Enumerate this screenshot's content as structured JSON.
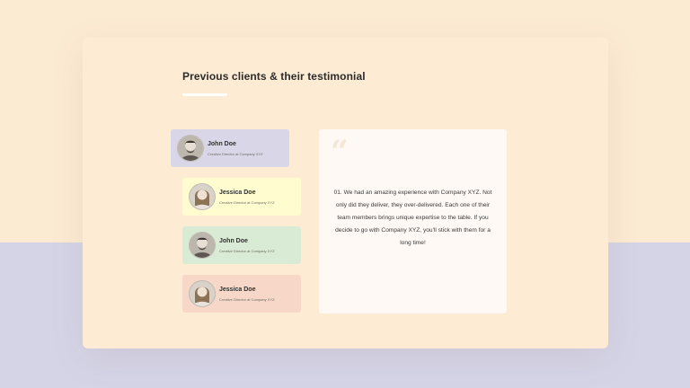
{
  "colors": {
    "page_top": "#FCEBD3",
    "page_bottom": "#D5D4E7",
    "card": "#FEEBD4",
    "client_1": "#D9D6E8",
    "client_2": "#FFFDCF",
    "client_3": "#D9EBD4",
    "client_4": "#F6D7C8",
    "quote_panel": "#FFF9F5"
  },
  "section": {
    "title": "Previous clients & their testimonial"
  },
  "clients": [
    {
      "name": "John Doe",
      "role": "Creative Director at Company XYZ",
      "avatar_icon": "man-avatar-icon"
    },
    {
      "name": "Jessica Doe",
      "role": "Creative Director at Company XYZ",
      "avatar_icon": "woman-avatar-icon"
    },
    {
      "name": "John Doe",
      "role": "Creative Director at Company XYZ",
      "avatar_icon": "man-avatar-icon"
    },
    {
      "name": "Jessica Doe",
      "role": "Creative Director at Company XYZ",
      "avatar_icon": "woman-avatar-icon"
    }
  ],
  "testimonial": {
    "quote_icon": "quote-icon",
    "text": "01. We had an amazing experience with Company XYZ. Not only did they deliver, they over-delivered. Each one of their team members brings unique expertise to the table. If you decide to go with Company XYZ, you'll stick with them for a long time!"
  }
}
